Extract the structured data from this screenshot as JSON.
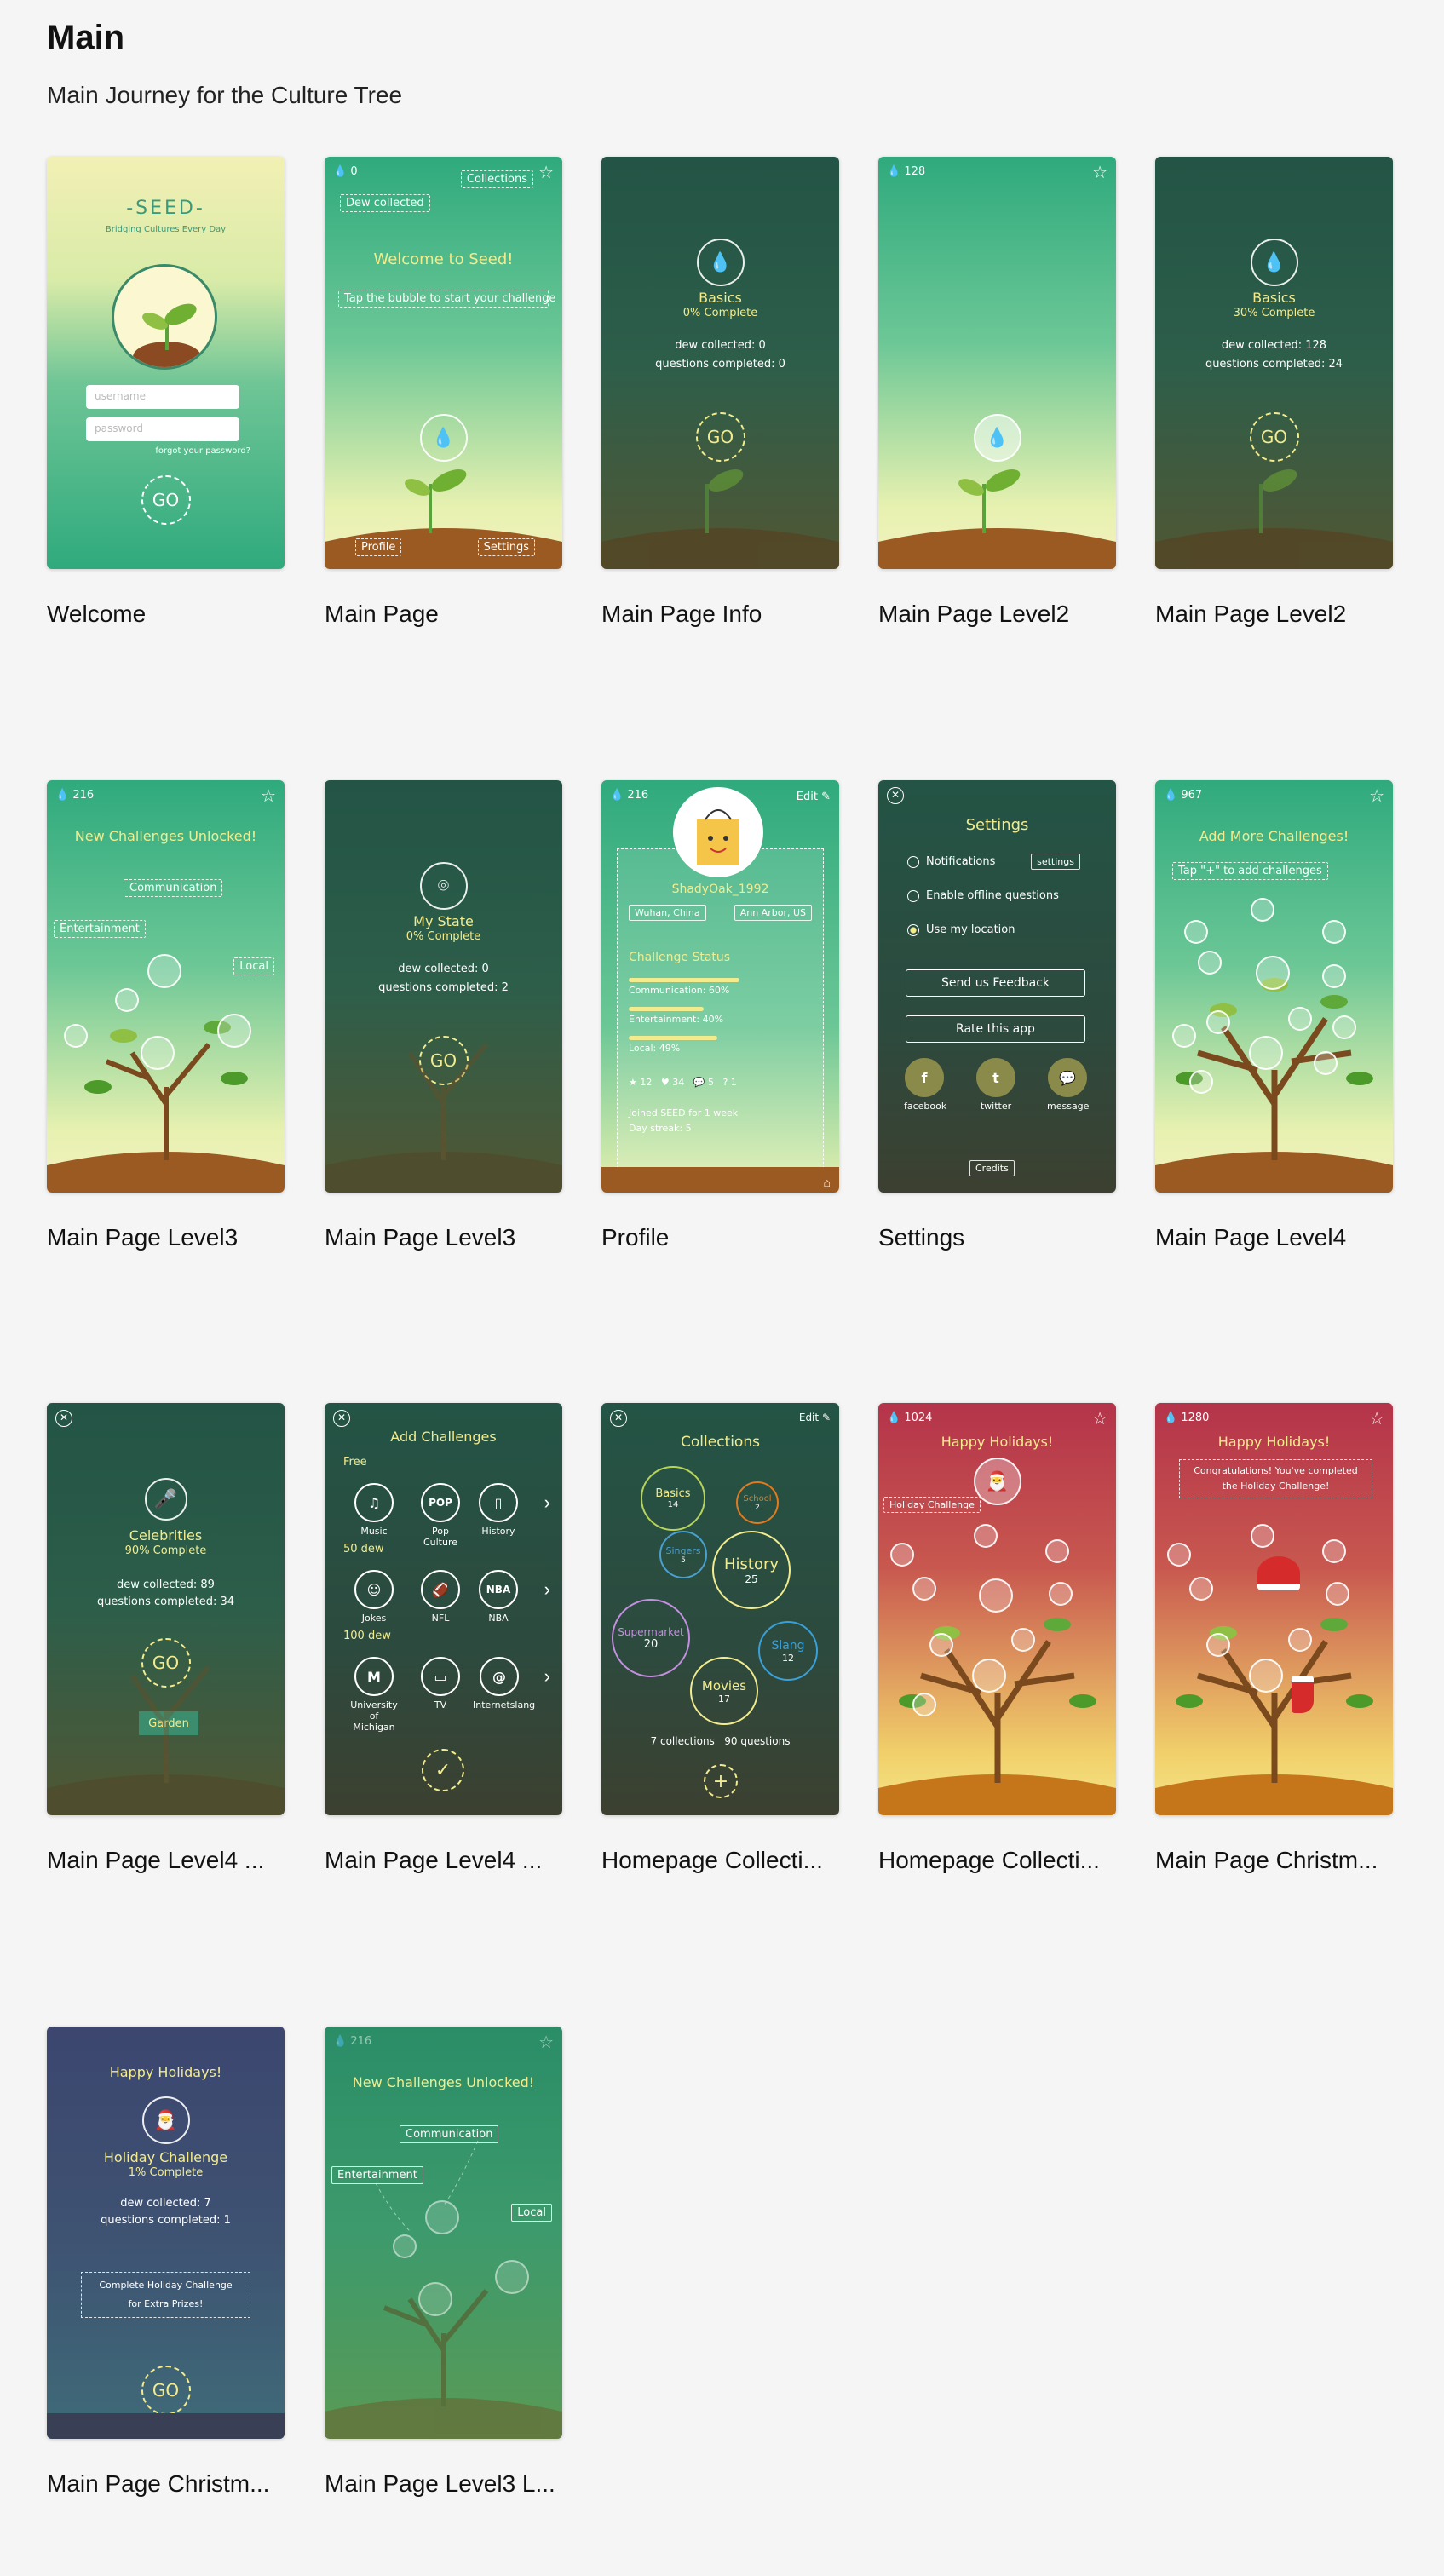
{
  "page": {
    "title": "Main",
    "subtitle": "Main Journey for the Culture Tree"
  },
  "colors": {
    "background": "#f5f5f5",
    "accent_yellow": "#f3ec8e",
    "green_light": "#2faa7d",
    "green_dark": "#235445",
    "holiday_red": "#b4334a",
    "holiday_blue": "#3c466f"
  },
  "cards": [
    {
      "label": "Welcome"
    },
    {
      "label": "Main Page"
    },
    {
      "label": "Main Page Info"
    },
    {
      "label": "Main Page Level2"
    },
    {
      "label": "Main Page Level2"
    },
    {
      "label": "Main Page Level3"
    },
    {
      "label": "Main Page Level3"
    },
    {
      "label": "Profile"
    },
    {
      "label": "Settings"
    },
    {
      "label": "Main Page Level4"
    },
    {
      "label": "Main Page Level4 ..."
    },
    {
      "label": "Main Page Level4 ..."
    },
    {
      "label": "Homepage Collecti..."
    },
    {
      "label": "Homepage Collecti..."
    },
    {
      "label": "Main Page Christm..."
    },
    {
      "label": "Main Page Christm..."
    },
    {
      "label": "Main Page Level3 L..."
    }
  ],
  "welcome": {
    "logo": "-SEED-",
    "tagline": "Bridging Cultures Every Day",
    "username_placeholder": "username",
    "password_placeholder": "password",
    "forgot": "forgot your password?",
    "go": "GO"
  },
  "main_page": {
    "dew": "0",
    "collections": "Collections",
    "dew_collected": "Dew collected",
    "welcome": "Welcome to Seed!",
    "tap": "Tap the bubble to start your challenge",
    "profile": "Profile",
    "settings": "Settings"
  },
  "info_basics": {
    "title": "Basics",
    "complete": "0% Complete",
    "dew": "dew collected: 0",
    "questions": "questions completed: 0",
    "go": "GO"
  },
  "level2": {
    "dew": "128"
  },
  "info_basics2": {
    "title": "Basics",
    "complete": "30% Complete",
    "dew": "dew collected: 128",
    "questions": "questions completed: 24",
    "go": "GO"
  },
  "level3": {
    "dew": "216",
    "headline": "New Challenges Unlocked!",
    "communication": "Communication",
    "entertainment": "Entertainment",
    "local": "Local"
  },
  "mystate": {
    "title": "My State",
    "complete": "0% Complete",
    "dew": "dew collected: 0",
    "questions": "questions completed: 2",
    "go": "GO"
  },
  "profile": {
    "dew": "216",
    "edit": "Edit",
    "username": "ShadyOak_1992",
    "from": "Wuhan, China",
    "to": "Ann Arbor, US",
    "status_title": "Challenge Status",
    "communication": "Communication: 60%",
    "communication_pct": 60,
    "entertainment": "Entertainment: 40%",
    "entertainment_pct": 40,
    "local": "Local: 49%",
    "local_pct": 49,
    "stars": "12",
    "likes": "34",
    "comments": "5",
    "questions": "1",
    "joined": "Joined SEED for 1 week",
    "streak": "Day streak: 5"
  },
  "settings": {
    "title": "Settings",
    "notifications": "Notifications",
    "settings_btn": "settings",
    "offline": "Enable offline questions",
    "location": "Use my location",
    "feedback": "Send us Feedback",
    "rate": "Rate this app",
    "facebook": "facebook",
    "twitter": "twitter",
    "message": "message",
    "credits": "Credits"
  },
  "level4": {
    "dew": "967",
    "headline": "Add More Challenges!",
    "tap": "Tap \"+\" to add challenges"
  },
  "celebrities": {
    "title": "Celebrities",
    "complete": "90% Complete",
    "dew": "dew collected: 89",
    "questions": "questions completed: 34",
    "go": "GO",
    "garden": "Garden"
  },
  "add_challenges": {
    "title": "Add Challenges",
    "free": "Free",
    "tier50": "50 dew",
    "tier100": "100 dew",
    "items": [
      "Music",
      "Pop Culture",
      "History",
      "Jokes",
      "NFL",
      "NBA",
      "University of Michigan",
      "TV",
      "Internetslang"
    ],
    "icons": [
      "♫",
      "POP",
      "▯",
      "☺",
      "🏈",
      "NBA",
      "M",
      "▭",
      "@"
    ]
  },
  "collections": {
    "title": "Collections",
    "edit": "Edit",
    "items": [
      {
        "name": "Basics",
        "count": "14",
        "color": "#b7d35a"
      },
      {
        "name": "School",
        "count": "2",
        "color": "#e27a1f"
      },
      {
        "name": "Singers",
        "count": "5",
        "color": "#4aa0d0"
      },
      {
        "name": "History",
        "count": "25",
        "color": "#f3ec8e"
      },
      {
        "name": "Supermarket",
        "count": "20",
        "color": "#c58fe0"
      },
      {
        "name": "Slang",
        "count": "12",
        "color": "#3aa0d8"
      },
      {
        "name": "Movies",
        "count": "17",
        "color": "#f3ec8e"
      }
    ],
    "summary_collections": "7 collections",
    "summary_questions": "90 questions",
    "add": "+"
  },
  "holiday1": {
    "dew": "1024",
    "headline": "Happy Holidays!",
    "tag": "Holiday Challenge"
  },
  "holiday2": {
    "dew": "1280",
    "headline": "Happy Holidays!",
    "congrats1": "Congratulations! You've completed",
    "congrats2": "the Holiday Challenge!"
  },
  "holiday_info": {
    "headline": "Happy Holidays!",
    "title": "Holiday Challenge",
    "complete": "1% Complete",
    "dew": "dew collected: 7",
    "questions": "questions completed: 1",
    "promo1": "Complete Holiday Challenge",
    "promo2": "for Extra Prizes!",
    "go": "GO"
  },
  "level3b": {
    "dew": "216",
    "headline": "New Challenges Unlocked!",
    "communication": "Communication",
    "entertainment": "Entertainment",
    "local": "Local"
  }
}
